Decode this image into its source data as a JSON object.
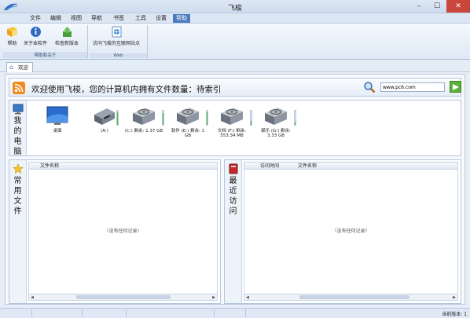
{
  "window": {
    "title": "飞梭",
    "minimize_glyph": "–",
    "maximize_glyph": "☐",
    "close_glyph": "✕",
    "logo_icon": "app-logo-icon"
  },
  "menu": [
    "文件",
    "编辑",
    "视图",
    "导航",
    "书签",
    "工具",
    "设置",
    "帮助"
  ],
  "menu_active": "帮助",
  "ribbon": {
    "groups": [
      {
        "label": "帮助和关于",
        "buttons": [
          {
            "label": "帮助",
            "icon": "help-book-icon"
          },
          {
            "label": "关于本软件",
            "icon": "info-icon"
          },
          {
            "label": "检查新版本",
            "icon": "update-icon"
          }
        ]
      },
      {
        "label": "Web",
        "buttons": [
          {
            "label": "访问飞梭的互联网站点",
            "icon": "web-page-icon"
          }
        ]
      }
    ]
  },
  "tab": {
    "label": "欢迎",
    "icon": "home-icon"
  },
  "welcome": {
    "text": "欢迎使用飞梭，您的计算机内拥有文件数量：待索引",
    "url_value": "www.pc6.com"
  },
  "my_computer": {
    "heading": [
      "我",
      "的",
      "电",
      "脑"
    ],
    "items": [
      {
        "label": "桌面",
        "type": "desktop",
        "usage": null
      },
      {
        "label": "(A:)",
        "type": "floppy",
        "usage": 0.9
      },
      {
        "label": "(C:) 剩余: 1.37 GB",
        "type": "disk",
        "usage": 0.85
      },
      {
        "label": "软件 (E:) 剩余: 1 GB",
        "type": "disk",
        "usage": 0.9
      },
      {
        "label": "文档 (F:) 剩余: 553.34 MB",
        "type": "disk",
        "usage": 0.3
      },
      {
        "label": "娱乐 (G:) 剩余: 3.33 GB",
        "type": "disk",
        "usage": 0.2
      }
    ]
  },
  "frequent": {
    "heading": [
      "常",
      "用",
      "文",
      "件"
    ],
    "columns": [
      "文件名称"
    ],
    "empty": "〈没有任何记录〉"
  },
  "recent": {
    "heading": [
      "最",
      "近",
      "访",
      "问"
    ],
    "columns": [
      "访问时间",
      "文件名称"
    ],
    "empty": "〈没有任何记录〉"
  },
  "status": {
    "version": "当前版本: 1"
  },
  "colors": {
    "accent": "#4b7bc0",
    "usage_fill": "#4cbf3a",
    "rss": "#f08c1d"
  }
}
